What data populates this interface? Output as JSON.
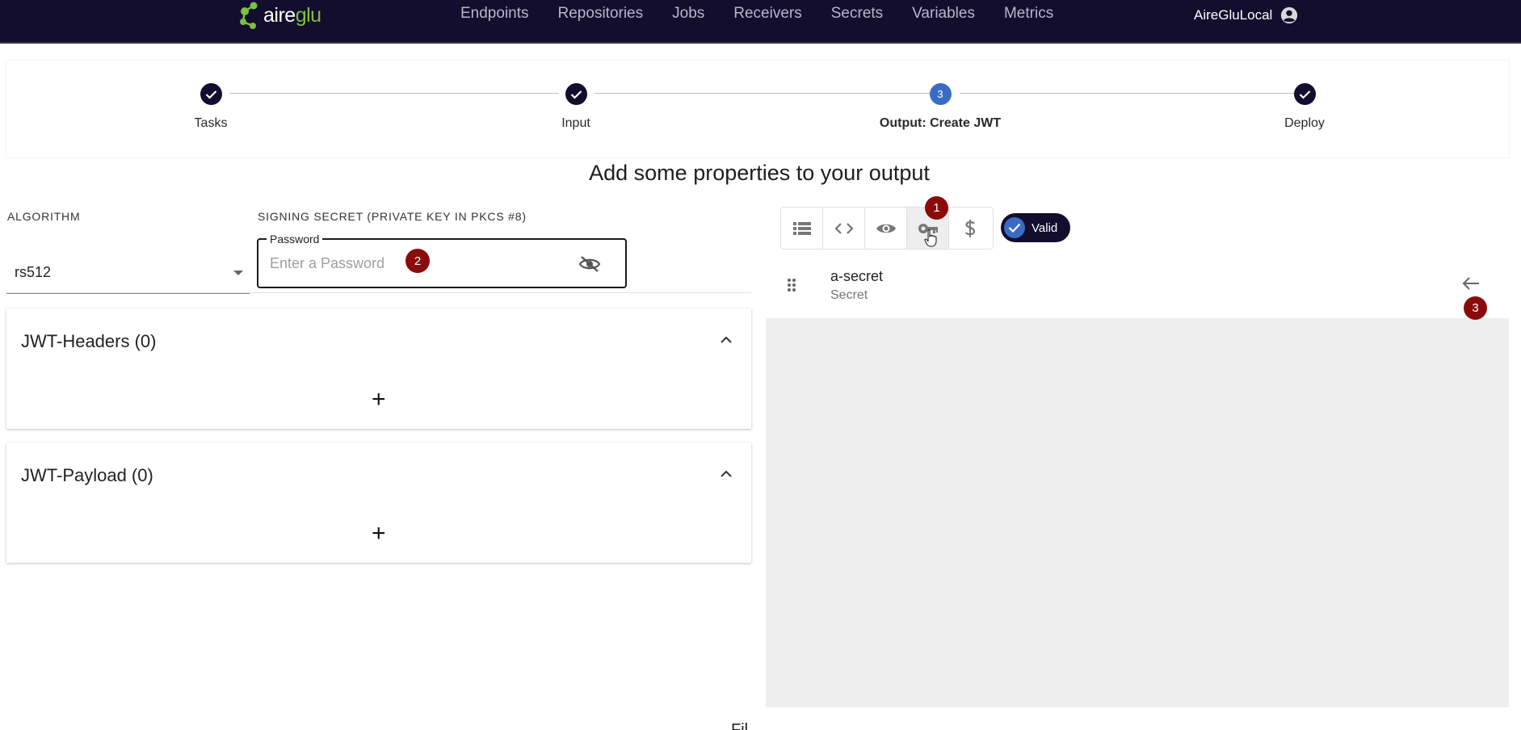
{
  "header": {
    "logo": {
      "prefix": "aire",
      "suffix": "glu"
    },
    "nav": [
      "Endpoints",
      "Repositories",
      "Jobs",
      "Receivers",
      "Secrets",
      "Variables",
      "Metrics"
    ],
    "user": "AireGluLocal"
  },
  "stepper": {
    "steps": [
      {
        "label": "Tasks",
        "state": "done"
      },
      {
        "label": "Input",
        "state": "done"
      },
      {
        "label": "Output: Create JWT",
        "state": "active",
        "number": "3"
      },
      {
        "label": "Deploy",
        "state": "done"
      }
    ]
  },
  "page": {
    "title": "Add some properties to your output"
  },
  "form": {
    "algorithm_label": "ALGORITHM",
    "algorithm_value": "rs512",
    "secret_label": "SIGNING SECRET (PRIVATE KEY IN PKCS #8)",
    "password_legend": "Password",
    "password_placeholder": "Enter a Password"
  },
  "sections": {
    "headers": {
      "title": "JWT-Headers (0)",
      "add": "+"
    },
    "payload": {
      "title": "JWT-Payload (0)",
      "add": "+"
    }
  },
  "toolbar": {
    "icons": [
      "list-icon",
      "code-icon",
      "eye-icon",
      "key-icon",
      "dollar-icon"
    ],
    "selected": "key-icon",
    "valid_label": "Valid"
  },
  "secrets": [
    {
      "name": "a-secret",
      "type": "Secret"
    }
  ],
  "badges": {
    "one": "1",
    "two": "2",
    "three": "3"
  },
  "footer": {
    "partial_text": "Fil"
  },
  "colors": {
    "nav_bg": "#130d2e",
    "accent": "#3a6cc6",
    "badge": "#8b0b0b",
    "logo_green": "#7bc043"
  }
}
